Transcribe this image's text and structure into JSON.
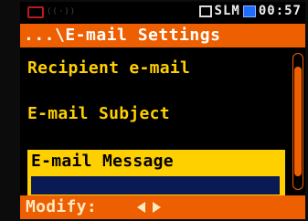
{
  "status_bar": {
    "mode": "SLM",
    "time": "00:57",
    "icons": [
      "device-icon",
      "signal-icon",
      "record-indicator-icon",
      "battery-indicator-icon"
    ]
  },
  "title": "...\\E-mail Settings",
  "menu": {
    "items": [
      {
        "label": "Recipient e-mail"
      },
      {
        "label": "E-mail Subject"
      },
      {
        "label": "E-mail Message",
        "selected": true,
        "value": ""
      }
    ]
  },
  "bottom_bar": {
    "label": "Modify:",
    "icons": [
      "left-arrow-icon",
      "right-arrow-icon"
    ]
  },
  "colors": {
    "accent": "#ed5f00",
    "label": "#ffd000",
    "selection": "#ffd000",
    "value_field": "#0a1a55",
    "background": "#000000"
  }
}
